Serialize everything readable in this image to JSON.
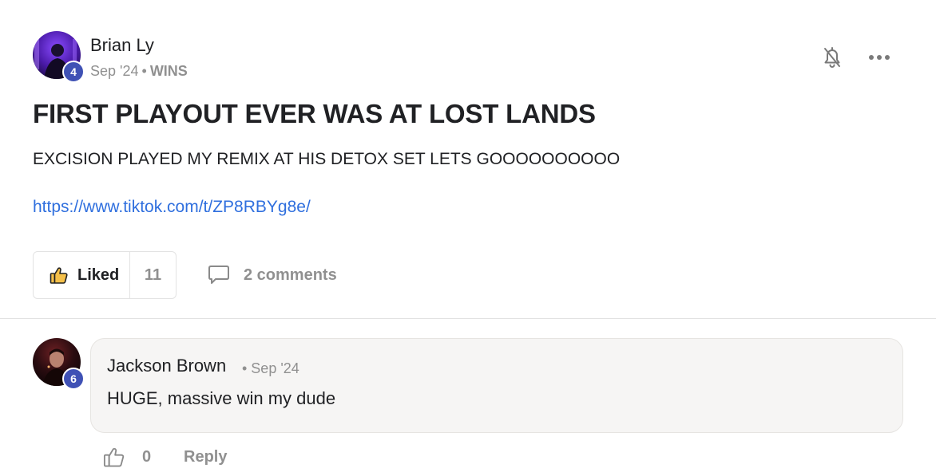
{
  "post": {
    "author": {
      "name": "Brian Ly",
      "level": "4",
      "avatar": "profile-photo-purple"
    },
    "date": "Sep '24",
    "meta_separator": "•",
    "category": "WINS",
    "title": "FIRST PLAYOUT EVER WAS AT LOST LANDS",
    "body": "EXCISION PLAYED MY REMIX AT HIS DETOX SET LETS GOOOOOOOOOO",
    "link": "https://www.tiktok.com/t/ZP8RBYg8e/",
    "actions": {
      "bell_icon": "bell-off-icon",
      "more_icon": "more-horizontal-icon",
      "like_label": "Liked",
      "like_icon": "thumbs-up-filled-icon",
      "like_count": "11",
      "comments_icon": "chat-bubble-icon",
      "comments_label": "2 comments"
    }
  },
  "comments": [
    {
      "author": "Jackson Brown",
      "level": "6",
      "avatar": "profile-photo-dark-red",
      "date": "• Sep '24",
      "text": "HUGE, massive win my dude",
      "like_icon": "thumbs-up-outline-icon",
      "like_count": "0",
      "reply_label": "Reply"
    }
  ],
  "colors": {
    "badge": "#3f51b5",
    "link": "#2f6fde",
    "muted": "#909090",
    "like_thumb": "#f5c04a"
  }
}
